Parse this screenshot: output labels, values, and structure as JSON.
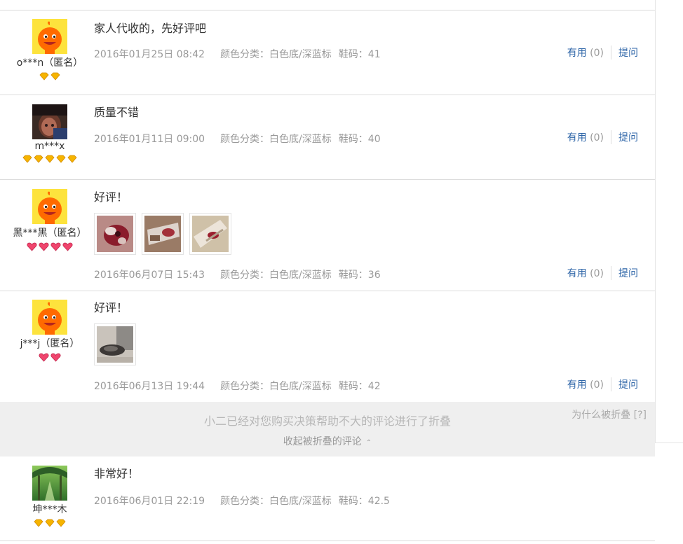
{
  "reviews": [
    {
      "user": "o***n（匿名）",
      "text": "家人代收的，先好评吧",
      "date": "2016年01月25日 08:42",
      "sku": "颜色分类：白色底/深蓝标",
      "size": "鞋码：41",
      "useful": "有用",
      "useful_count": "(0)",
      "ask": "提问",
      "avatar": "mascot-avatar",
      "badges": [
        "yellow-diamond-icon",
        "yellow-diamond-icon"
      ]
    },
    {
      "user": "m***x",
      "text": "质量不错",
      "date": "2016年01月11日 09:00",
      "sku": "颜色分类：白色底/深蓝标",
      "size": "鞋码：40",
      "useful": "有用",
      "useful_count": "(0)",
      "ask": "提问",
      "avatar": "photo-avatar",
      "badges": [
        "yellow-diamond-icon",
        "yellow-diamond-icon",
        "yellow-diamond-icon",
        "yellow-diamond-icon",
        "yellow-diamond-icon"
      ]
    },
    {
      "user": "黑***黑（匿名）",
      "text": "好评！",
      "date": "2016年06月07日 15:43",
      "sku": "颜色分类：白色底/深蓝标",
      "size": "鞋码：36",
      "useful": "有用",
      "useful_count": "(0)",
      "ask": "提问",
      "avatar": "mascot-avatar",
      "badges": [
        "red-heart-icon",
        "red-heart-icon",
        "red-heart-icon",
        "red-heart-icon"
      ],
      "photos": 3
    },
    {
      "user": "j***j（匿名）",
      "text": "好评！",
      "date": "2016年06月13日 19:44",
      "sku": "颜色分类：白色底/深蓝标",
      "size": "鞋码：42",
      "useful": "有用",
      "useful_count": "(0)",
      "ask": "提问",
      "avatar": "mascot-avatar",
      "badges": [
        "red-heart-icon",
        "red-heart-icon"
      ],
      "photos": 1
    }
  ],
  "fold": {
    "message": "小二已经对您购买决策帮助不大的评论进行了折叠",
    "collapse": "收起被折叠的评论",
    "why": "为什么被折叠 [?]"
  },
  "folded_review": {
    "user": "坤***木",
    "text": "非常好！",
    "date": "2016年06月01日 22:19",
    "sku": "颜色分类：白色底/深蓝标",
    "size": "鞋码：42.5",
    "avatar": "forest-avatar",
    "badges": [
      "yellow-diamond-icon",
      "yellow-diamond-icon",
      "yellow-diamond-icon"
    ]
  },
  "colors": {
    "link": "#2f66a8",
    "muted": "#999999",
    "fold_bg": "#efefef",
    "mascot": "#ff6a00"
  }
}
